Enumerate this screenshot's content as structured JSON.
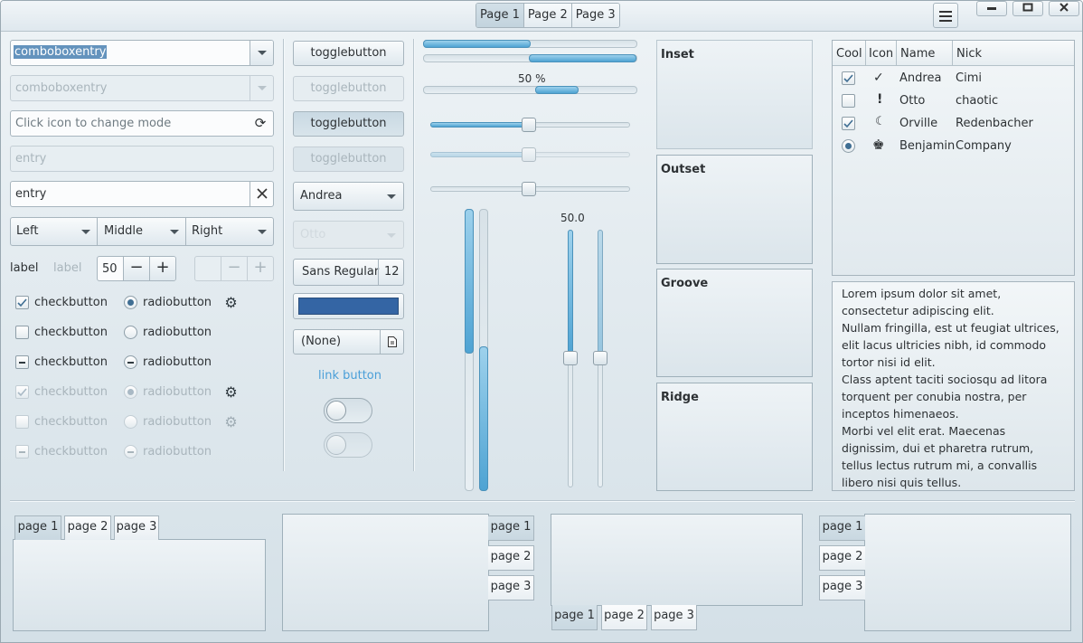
{
  "header": {
    "stack_tabs": [
      "Page 1",
      "Page 2",
      "Page 3"
    ],
    "selected_tab": "Page 1",
    "icons": [
      "hamburger-menu-icon",
      "minimize-icon",
      "maximize-icon",
      "close-icon"
    ]
  },
  "col1": {
    "combo_value": "comboboxentry",
    "combo_disabled_value": "comboboxentry",
    "mode_placeholder": "Click icon to change mode",
    "entry_disabled": "entry",
    "entry_value": "entry",
    "seg": [
      "Left",
      "Middle",
      "Right"
    ],
    "label1": "label",
    "label2": "label",
    "spin_value": "50",
    "checks": [
      "checkbutton",
      "checkbutton",
      "checkbutton",
      "checkbutton",
      "checkbutton",
      "checkbutton"
    ],
    "radios": [
      "radiobutton",
      "radiobutton",
      "radiobutton",
      "radiobutton",
      "radiobutton",
      "radiobutton"
    ]
  },
  "col2": {
    "toggles": [
      "togglebutton",
      "togglebutton",
      "togglebutton",
      "togglebutton"
    ],
    "combo": "Andrea",
    "combo_disabled": "Otto",
    "font_name": "Sans Regular",
    "font_size": "12",
    "color": "#3465a4",
    "file": "(None)",
    "link": "link button",
    "switch1_on": false,
    "switch2_on": false
  },
  "col3": {
    "progress_fractions": [
      0.5,
      0.5,
      0.5
    ],
    "progress_label": "50 %",
    "scale_value": "50.0",
    "hscale_values": [
      0.5,
      0.5,
      0.5
    ],
    "vscale_value": 0.5
  },
  "frames": [
    "Inset",
    "Outset",
    "Groove",
    "Ridge"
  ],
  "tree": {
    "headers": [
      "Cool",
      "Icon",
      "Name",
      "Nick"
    ],
    "rows": [
      {
        "cool": "check",
        "icon": "✓",
        "name": "Andrea",
        "nick": "Cimi"
      },
      {
        "cool": "empty",
        "icon": "!",
        "name": "Otto",
        "nick": "chaotic"
      },
      {
        "cool": "check",
        "icon": "☾",
        "name": "Orville",
        "nick": "Redenbacher"
      },
      {
        "cool": "radio",
        "icon": "♚",
        "name": "Benjamin",
        "nick": "Company"
      }
    ]
  },
  "textview": [
    "Lorem ipsum dolor sit amet, consectetur adipiscing elit.",
    "Nullam fringilla, est ut feugiat ultrices, elit lacus ultricies nibh, id commodo tortor nisi id elit.",
    "Class aptent taciti sociosqu ad litora torquent per conubia nostra, per inceptos himenaeos.",
    "Morbi vel elit erat. Maecenas dignissim, dui et pharetra rutrum, tellus lectus rutrum mi, a convallis libero nisi quis tellus."
  ],
  "notebook_tabs": [
    "page 1",
    "page 2",
    "page 3"
  ]
}
